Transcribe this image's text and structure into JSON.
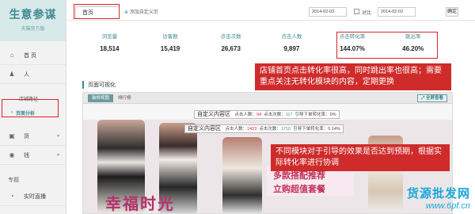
{
  "app": {
    "title": "生意参谋",
    "subtitle": "天猫官方版"
  },
  "sidebar": {
    "items": [
      {
        "label": "首 页",
        "icon": "home-icon",
        "glyph": "⌂"
      },
      {
        "label": "人",
        "icon": "person-icon",
        "glyph": "♟"
      }
    ],
    "sub_items": [
      "店铺路径",
      "页面分析"
    ],
    "active_arrow": "›",
    "more_items": [
      {
        "label": "货",
        "icon": "goods-icon",
        "glyph": "▣",
        "caret": "▾"
      },
      {
        "label": "钱",
        "icon": "money-icon",
        "glyph": "◉",
        "caret": "▾"
      }
    ],
    "section_label": "专题",
    "bottom_item": {
      "label": "实时直播",
      "icon": "live-icon",
      "glyph": "◔"
    }
  },
  "topbar": {
    "home_tab": "首页",
    "add_page": "添加自定义页",
    "date_from": "2014-02-03",
    "compare_label": "对比",
    "date_to": "2014-02-02",
    "confirm": "确定"
  },
  "stats": [
    {
      "label": "浏览量",
      "value": "18,514"
    },
    {
      "label": "访客数",
      "value": "15,419"
    },
    {
      "label": "点击次数",
      "value": "26,673"
    },
    {
      "label": "点击人数",
      "value": "9,897"
    },
    {
      "label": "点击转化率",
      "value": "144.07%"
    },
    {
      "label": "跳出率",
      "value": "46.20%"
    }
  ],
  "section": {
    "title": "页面可视化"
  },
  "preview": {
    "tabs": [
      "装修视图",
      "排行榜"
    ],
    "fullscreen": "全屏查看",
    "overlays": [
      {
        "title": "自定义内容区",
        "clicks_people_label": "点击人数：",
        "clicks_people": "94",
        "clicks_label": "点击次数：",
        "clicks": "117",
        "guide_label": "引导下单转化率：",
        "guide": "0%"
      },
      {
        "title": "自定义内容区",
        "clicks_people_label": "点击人数：",
        "clicks_people": "1423",
        "clicks_label": "点击次数：",
        "clicks": "1710",
        "guide_label": "引导下单转化率：",
        "guide": "0.14%"
      }
    ],
    "banner_text": "幸福时光",
    "promo_line1": "多款搭配推荐",
    "promo_line2": "立购超值套餐"
  },
  "callouts": [
    "店铺首页点击转化率很高，同时跳出率也很高；需要重点关注无转化模块的内容，定期更换",
    "不同模块对于引导的效果是否达到预期，根据实际转化率进行协调"
  ],
  "watermark": {
    "line1": "货源批发网",
    "line2": "www.6pf.cn"
  },
  "colors": {
    "accent": "#3e8a8f",
    "callout": "#cf2b2b",
    "highlight": "#d9252a"
  }
}
